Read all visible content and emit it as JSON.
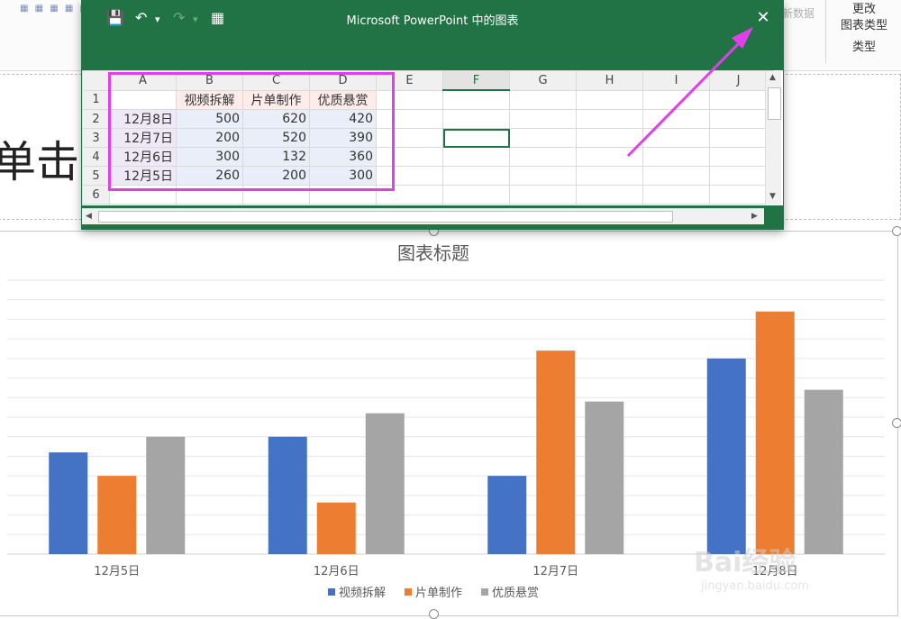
{
  "ribbon": {
    "icons_text": "▦ ▦ ▦ ▦ ▦ ▦",
    "faded_label": "新数据",
    "change_line1": "更改",
    "change_line2": "图表类型",
    "group_label": "类型"
  },
  "slide": {
    "title_fragment": "单击."
  },
  "spreadsheet": {
    "title": "Microsoft PowerPoint 中的图表",
    "toolbar": {
      "save_icon": "💾",
      "undo_icon": "↶",
      "undo_drop": "▾",
      "redo_icon": "↷",
      "redo_drop": "▾",
      "excel_icon": "▦"
    },
    "close_label": "✕",
    "columns": [
      "A",
      "B",
      "C",
      "D",
      "E",
      "F",
      "G",
      "H",
      "I",
      "J"
    ],
    "rows": [
      {
        "n": "1",
        "cells": [
          "",
          "视频拆解",
          "片单制作",
          "优质悬赏",
          "",
          "",
          "",
          "",
          "",
          ""
        ]
      },
      {
        "n": "2",
        "cells": [
          "12月8日",
          "500",
          "620",
          "420",
          "",
          "",
          "",
          "",
          "",
          ""
        ]
      },
      {
        "n": "3",
        "cells": [
          "12月7日",
          "200",
          "520",
          "390",
          "",
          "",
          "",
          "",
          "",
          ""
        ]
      },
      {
        "n": "4",
        "cells": [
          "12月6日",
          "300",
          "132",
          "360",
          "",
          "",
          "",
          "",
          "",
          ""
        ]
      },
      {
        "n": "5",
        "cells": [
          "12月5日",
          "260",
          "200",
          "300",
          "",
          "",
          "",
          "",
          "",
          ""
        ]
      },
      {
        "n": "6",
        "cells": [
          "",
          "",
          "",
          "",
          "",
          "",
          "",
          "",
          "",
          ""
        ]
      }
    ],
    "scroll_up": "▲",
    "scroll_down": "▼",
    "scroll_left": "◀",
    "scroll_right": "▶"
  },
  "chart_data": {
    "type": "bar",
    "title": "图表标题",
    "categories": [
      "12月5日",
      "12月6日",
      "12月7日",
      "12月8日"
    ],
    "series": [
      {
        "name": "视频拆解",
        "values": [
          260,
          300,
          200,
          500
        ],
        "color": "#4472c4"
      },
      {
        "name": "片单制作",
        "values": [
          200,
          132,
          520,
          620
        ],
        "color": "#ed7d31"
      },
      {
        "name": "优质悬赏",
        "values": [
          300,
          360,
          390,
          420
        ],
        "color": "#a5a5a5"
      }
    ],
    "ylim": [
      0,
      700
    ],
    "grid": true,
    "legend": "bottom"
  },
  "watermark": {
    "brand": "Bai经验",
    "url": "jingyan.baidu.com"
  }
}
